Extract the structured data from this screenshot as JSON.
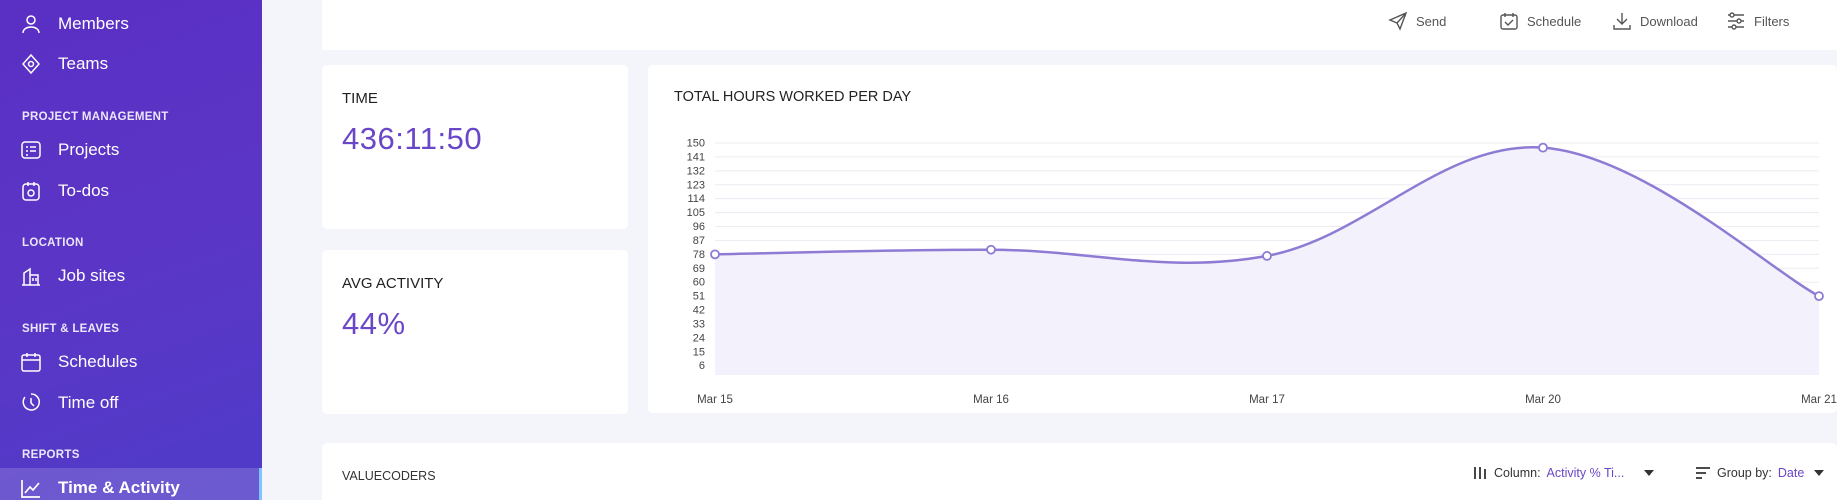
{
  "sidebar": {
    "items_top": [
      {
        "label": "Members",
        "icon": "person-icon"
      },
      {
        "label": "Teams",
        "icon": "teams-icon"
      }
    ],
    "sections": [
      {
        "title": "PROJECT MANAGEMENT",
        "items": [
          {
            "label": "Projects",
            "icon": "projects-icon"
          },
          {
            "label": "To-dos",
            "icon": "todo-icon"
          }
        ]
      },
      {
        "title": "LOCATION",
        "items": [
          {
            "label": "Job sites",
            "icon": "building-icon"
          }
        ]
      },
      {
        "title": "SHIFT & LEAVES",
        "items": [
          {
            "label": "Schedules",
            "icon": "calendar-icon"
          },
          {
            "label": "Time off",
            "icon": "clock-icon"
          }
        ]
      },
      {
        "title": "REPORTS",
        "items": [
          {
            "label": "Time & Activity",
            "icon": "line-chart-icon",
            "active": true
          }
        ]
      }
    ]
  },
  "toolbar": {
    "send": "Send",
    "schedule": "Schedule",
    "download": "Download",
    "filters": "Filters"
  },
  "stats": {
    "time_title": "TIME",
    "time_value": "436:11:50",
    "activity_title": "AVG ACTIVITY",
    "activity_value": "44%"
  },
  "chart_data": {
    "type": "line",
    "title": "TOTAL HOURS WORKED PER DAY",
    "categories": [
      "Mar 15",
      "Mar 16",
      "Mar 17",
      "Mar 20",
      "Mar 21"
    ],
    "values": [
      78,
      81,
      77,
      147,
      51
    ],
    "yticks": [
      150,
      141,
      132,
      123,
      114,
      105,
      96,
      87,
      78,
      69,
      60,
      51,
      42,
      33,
      24,
      15,
      6
    ],
    "ylim": [
      0,
      150
    ],
    "color": "#8e7bd4",
    "fill": "#f3f1fc",
    "smooth": true,
    "grid": true
  },
  "report": {
    "title": "VALUECODERS",
    "column_label": "Column:",
    "column_value": "Activity % Ti...",
    "group_label": "Group by:",
    "group_value": "Date"
  }
}
